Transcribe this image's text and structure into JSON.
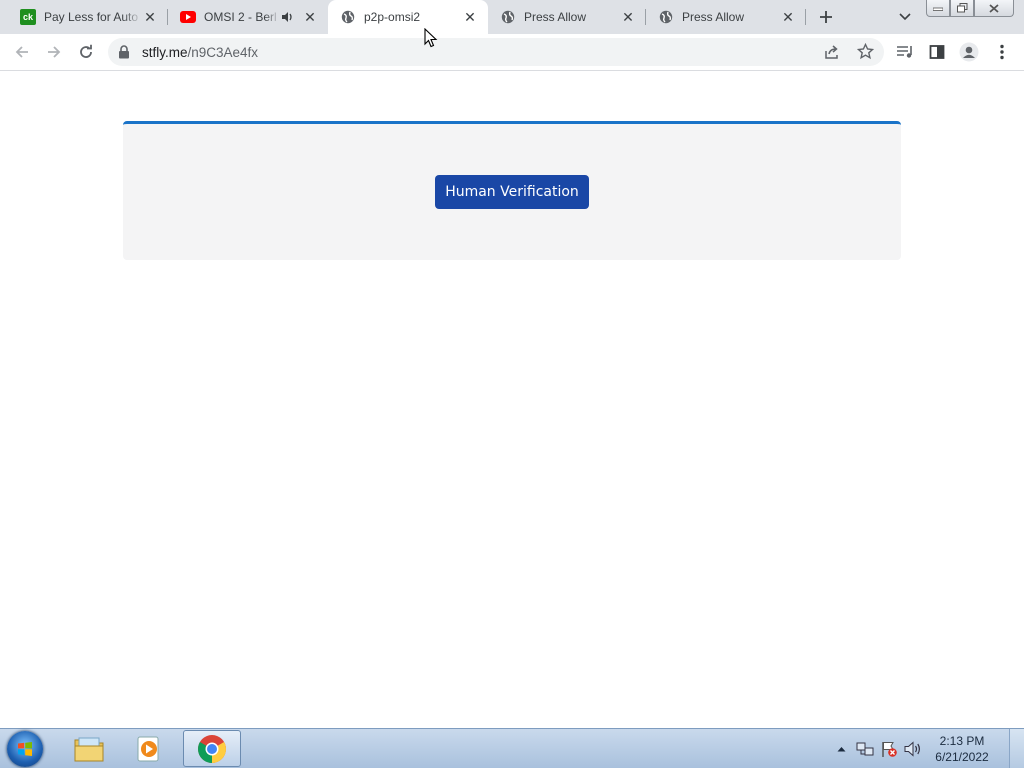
{
  "tabs": [
    {
      "title": "Pay Less for Auto",
      "favicon": "ck-logo-icon"
    },
    {
      "title": "OMSI 2 - Berl",
      "favicon": "youtube-icon",
      "audio": "speaker-icon"
    },
    {
      "title": "p2p-omsi2",
      "favicon": "globe-icon",
      "active": true
    },
    {
      "title": "Press Allow",
      "favicon": "globe-icon"
    },
    {
      "title": "Press Allow",
      "favicon": "globe-icon"
    }
  ],
  "tab_favicon_ck": "ck",
  "omnibox": {
    "domain": "stfly.me",
    "path": "/n9C3Ae4fx"
  },
  "page": {
    "button_label": "Human Verification"
  },
  "taskbar": {
    "clock_time": "2:13 PM",
    "clock_date": "6/21/2022"
  },
  "colors": {
    "accent": "#1a73c8",
    "button": "#1a47a6",
    "card_bg": "#f4f4f5",
    "tabstrip": "#dee1e6"
  }
}
